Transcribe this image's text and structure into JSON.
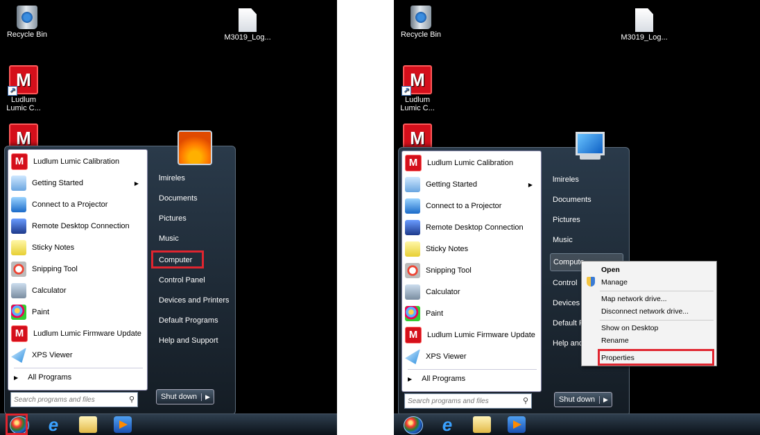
{
  "desktop": {
    "recycle_bin": "Recycle Bin",
    "file_icon": "M3019_Log...",
    "ludlum_shortcut": "Ludlum\nLumic C..."
  },
  "start_menu": {
    "programs": [
      {
        "label": "Ludlum Lumic Calibration",
        "icon": "ludlum-icon",
        "submenu": false
      },
      {
        "label": "Getting Started",
        "icon": "getting-started-icon",
        "submenu": true
      },
      {
        "label": "Connect to a Projector",
        "icon": "projector-icon",
        "submenu": false
      },
      {
        "label": "Remote Desktop Connection",
        "icon": "remote-desktop-icon",
        "submenu": false
      },
      {
        "label": "Sticky Notes",
        "icon": "sticky-notes-icon",
        "submenu": false
      },
      {
        "label": "Snipping Tool",
        "icon": "snipping-tool-icon",
        "submenu": false
      },
      {
        "label": "Calculator",
        "icon": "calculator-icon",
        "submenu": false
      },
      {
        "label": "Paint",
        "icon": "paint-icon",
        "submenu": false
      },
      {
        "label": "Ludlum Lumic Firmware Update",
        "icon": "ludlum-icon",
        "submenu": false
      },
      {
        "label": "XPS Viewer",
        "icon": "xps-viewer-icon",
        "submenu": false
      }
    ],
    "all_programs": "All Programs",
    "search_placeholder": "Search programs and files",
    "right_items": [
      "lmireles",
      "Documents",
      "Pictures",
      "Music",
      "Computer",
      "Control Panel",
      "Devices and Printers",
      "Default Programs",
      "Help and Support"
    ],
    "right_items_truncated": [
      "lmireles",
      "Documents",
      "Pictures",
      "Music",
      "Compute",
      "Control",
      "Devices",
      "Default P",
      "Help and"
    ],
    "shutdown": "Shut down",
    "ludlum_glyph": "M"
  },
  "context_menu": {
    "items": [
      "Open",
      "Manage",
      "Map network drive...",
      "Disconnect network drive...",
      "Show on Desktop",
      "Rename",
      "Properties"
    ]
  },
  "taskbar": {
    "icons": [
      "start-orb-icon",
      "internet-explorer-icon",
      "windows-explorer-icon",
      "media-player-icon"
    ]
  },
  "colors": {
    "highlight": "#e0252f",
    "desktop": "#000000",
    "menu_dark": "#1c2733"
  }
}
